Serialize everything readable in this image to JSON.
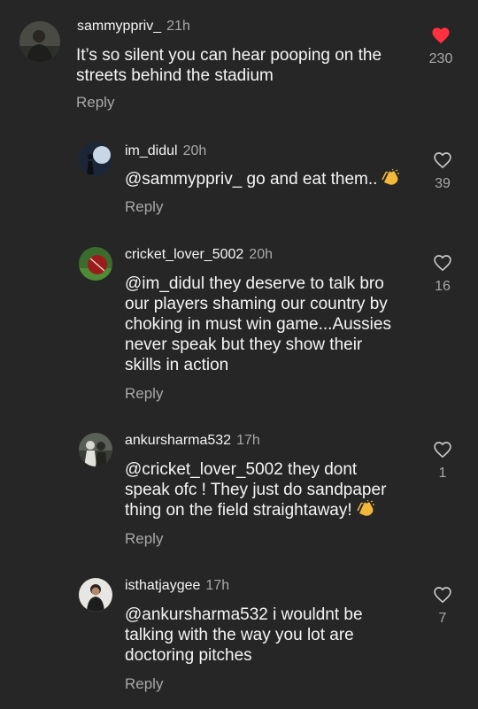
{
  "comments": [
    {
      "username": "sammyppriv_",
      "time": "21h",
      "mention": "",
      "text": "It’s so silent you can hear pooping on the\nstreets behind the stadium",
      "reply": "Reply",
      "likes": "230",
      "liked": true,
      "avatar": "person-photo"
    },
    {
      "username": "im_didul",
      "time": "20h",
      "mention": "@sammyppriv_",
      "text": " go and eat them..",
      "emoji": "clapping-hands",
      "reply": "Reply",
      "likes": "39",
      "liked": false,
      "avatar": "silhouette-photo"
    },
    {
      "username": "cricket_lover_5002",
      "time": "20h",
      "mention": "@im_didul",
      "text": " they deserve to talk bro\nour players shaming our country by\nchoking in must win game...Aussies\nnever speak but they show their\nskills in action",
      "reply": "Reply",
      "likes": "16",
      "liked": false,
      "avatar": "cricket-ball-photo"
    },
    {
      "username": "ankursharma532",
      "time": "17h",
      "mention": "@cricket_lover_5002",
      "text": "  they dont\nspeak ofc ! They just do sandpaper\nthing on the field straightaway!",
      "emoji": "clapping-hands",
      "reply": "Reply",
      "likes": "1",
      "liked": false,
      "avatar": "group-photo"
    },
    {
      "username": "isthatjaygee",
      "time": "17h",
      "mention": "@ankursharma532",
      "text": " i wouldnt be\ntalking with the way you lot are\ndoctoring pitches",
      "reply": "Reply",
      "likes": "7",
      "liked": false,
      "avatar": "person-portrait"
    }
  ],
  "colors": {
    "background": "#262626",
    "text": "#f5f5f5",
    "muted": "#a8a8a8",
    "liked_heart": "#ff3040"
  }
}
